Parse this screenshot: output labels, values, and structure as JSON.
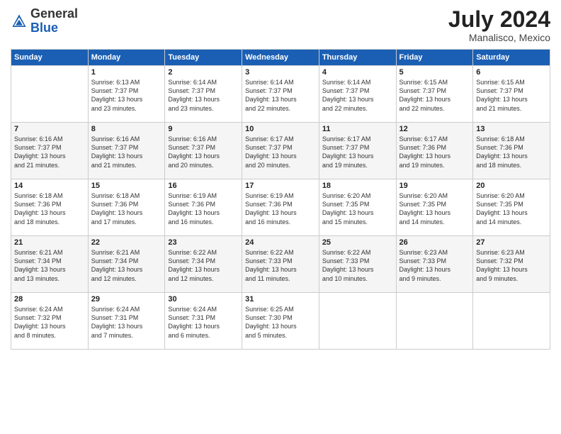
{
  "header": {
    "logo_general": "General",
    "logo_blue": "Blue",
    "month_year": "July 2024",
    "location": "Manalisco, Mexico"
  },
  "days_of_week": [
    "Sunday",
    "Monday",
    "Tuesday",
    "Wednesday",
    "Thursday",
    "Friday",
    "Saturday"
  ],
  "weeks": [
    [
      {
        "day": "",
        "info": ""
      },
      {
        "day": "1",
        "info": "Sunrise: 6:13 AM\nSunset: 7:37 PM\nDaylight: 13 hours\nand 23 minutes."
      },
      {
        "day": "2",
        "info": "Sunrise: 6:14 AM\nSunset: 7:37 PM\nDaylight: 13 hours\nand 23 minutes."
      },
      {
        "day": "3",
        "info": "Sunrise: 6:14 AM\nSunset: 7:37 PM\nDaylight: 13 hours\nand 22 minutes."
      },
      {
        "day": "4",
        "info": "Sunrise: 6:14 AM\nSunset: 7:37 PM\nDaylight: 13 hours\nand 22 minutes."
      },
      {
        "day": "5",
        "info": "Sunrise: 6:15 AM\nSunset: 7:37 PM\nDaylight: 13 hours\nand 22 minutes."
      },
      {
        "day": "6",
        "info": "Sunrise: 6:15 AM\nSunset: 7:37 PM\nDaylight: 13 hours\nand 21 minutes."
      }
    ],
    [
      {
        "day": "7",
        "info": ""
      },
      {
        "day": "8",
        "info": "Sunrise: 6:16 AM\nSunset: 7:37 PM\nDaylight: 13 hours\nand 21 minutes."
      },
      {
        "day": "9",
        "info": "Sunrise: 6:16 AM\nSunset: 7:37 PM\nDaylight: 13 hours\nand 20 minutes."
      },
      {
        "day": "10",
        "info": "Sunrise: 6:17 AM\nSunset: 7:37 PM\nDaylight: 13 hours\nand 20 minutes."
      },
      {
        "day": "11",
        "info": "Sunrise: 6:17 AM\nSunset: 7:37 PM\nDaylight: 13 hours\nand 19 minutes."
      },
      {
        "day": "12",
        "info": "Sunrise: 6:17 AM\nSunset: 7:36 PM\nDaylight: 13 hours\nand 19 minutes."
      },
      {
        "day": "13",
        "info": "Sunrise: 6:18 AM\nSunset: 7:36 PM\nDaylight: 13 hours\nand 18 minutes."
      }
    ],
    [
      {
        "day": "14",
        "info": ""
      },
      {
        "day": "15",
        "info": "Sunrise: 6:18 AM\nSunset: 7:36 PM\nDaylight: 13 hours\nand 17 minutes."
      },
      {
        "day": "16",
        "info": "Sunrise: 6:19 AM\nSunset: 7:36 PM\nDaylight: 13 hours\nand 16 minutes."
      },
      {
        "day": "17",
        "info": "Sunrise: 6:19 AM\nSunset: 7:36 PM\nDaylight: 13 hours\nand 16 minutes."
      },
      {
        "day": "18",
        "info": "Sunrise: 6:20 AM\nSunset: 7:35 PM\nDaylight: 13 hours\nand 15 minutes."
      },
      {
        "day": "19",
        "info": "Sunrise: 6:20 AM\nSunset: 7:35 PM\nDaylight: 13 hours\nand 14 minutes."
      },
      {
        "day": "20",
        "info": "Sunrise: 6:20 AM\nSunset: 7:35 PM\nDaylight: 13 hours\nand 14 minutes."
      }
    ],
    [
      {
        "day": "21",
        "info": ""
      },
      {
        "day": "22",
        "info": "Sunrise: 6:21 AM\nSunset: 7:34 PM\nDaylight: 13 hours\nand 12 minutes."
      },
      {
        "day": "23",
        "info": "Sunrise: 6:22 AM\nSunset: 7:34 PM\nDaylight: 13 hours\nand 12 minutes."
      },
      {
        "day": "24",
        "info": "Sunrise: 6:22 AM\nSunset: 7:33 PM\nDaylight: 13 hours\nand 11 minutes."
      },
      {
        "day": "25",
        "info": "Sunrise: 6:22 AM\nSunset: 7:33 PM\nDaylight: 13 hours\nand 10 minutes."
      },
      {
        "day": "26",
        "info": "Sunrise: 6:23 AM\nSunset: 7:33 PM\nDaylight: 13 hours\nand 9 minutes."
      },
      {
        "day": "27",
        "info": "Sunrise: 6:23 AM\nSunset: 7:32 PM\nDaylight: 13 hours\nand 9 minutes."
      }
    ],
    [
      {
        "day": "28",
        "info": "Sunrise: 6:24 AM\nSunset: 7:32 PM\nDaylight: 13 hours\nand 8 minutes."
      },
      {
        "day": "29",
        "info": "Sunrise: 6:24 AM\nSunset: 7:31 PM\nDaylight: 13 hours\nand 7 minutes."
      },
      {
        "day": "30",
        "info": "Sunrise: 6:24 AM\nSunset: 7:31 PM\nDaylight: 13 hours\nand 6 minutes."
      },
      {
        "day": "31",
        "info": "Sunrise: 6:25 AM\nSunset: 7:30 PM\nDaylight: 13 hours\nand 5 minutes."
      },
      {
        "day": "",
        "info": ""
      },
      {
        "day": "",
        "info": ""
      },
      {
        "day": "",
        "info": ""
      }
    ]
  ],
  "week1_day7_info": "Sunrise: 6:15 AM\nSunset: 7:37 PM\nDaylight: 13 hours\nand 21 minutes.",
  "week2_day1_info": "Sunrise: 6:16 AM\nSunset: 7:37 PM\nDaylight: 13 hours\nand 21 minutes.",
  "week3_day1_info": "Sunrise: 6:18 AM\nSunset: 7:36 PM\nDaylight: 13 hours\nand 18 minutes.",
  "week4_day1_info": "Sunrise: 6:21 AM\nSunset: 7:34 PM\nDaylight: 13 hours\nand 13 minutes."
}
